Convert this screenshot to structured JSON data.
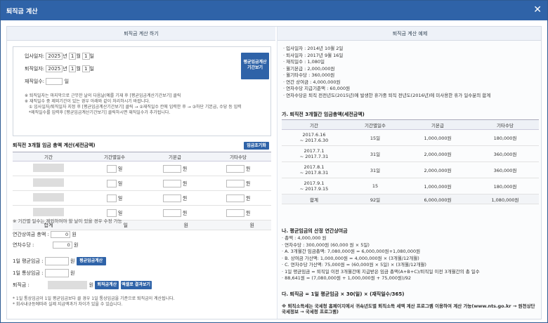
{
  "title": "퇴직금 계산",
  "close": "✕",
  "left": {
    "header": "퇴직금 계산 하기",
    "entry_label": "입사일자:",
    "leave_label": "퇴직일자:",
    "days_label": "재직일수:",
    "year": "2025",
    "y": "년",
    "month": "1",
    "m": "월",
    "day": "1",
    "d": "일",
    "days_unit": "일",
    "avg_btn": "평균임금계산 기간보기",
    "notes": [
      "※ 퇴직일자는 마지막으로 근무한 날의 다음날(예를 기재 후 [평균임금계산기간보기] 클릭",
      "※ 재직일수 중 제외기간이 있는 경우 아래와 같이 처리하시기 바랍니다.",
      "① 입사일자/퇴직일자 지정 후 [평균임금계산기간보기] 클릭 → ②재직일수 칸에 입력한 후 → ③하단 기본급, 수당 등 입력",
      "*제직일수를 입력후 [평균임금계산기간보기] 클릭하시면 재직일수가 추가됩니다."
    ],
    "section": "퇴직전 3개월 임금 총액 계산(세전금액)",
    "reset_btn": "임금초기화",
    "cols": [
      "기간",
      "기간별일수",
      "기본급",
      "기타수당"
    ],
    "day_u": "일",
    "won": "원",
    "sum": {
      "label": "합계",
      "d": "일",
      "w1": "원",
      "w2": "원"
    },
    "hint": "※ 기간별 일수는 제외하여야 할 날이 있을 경우 수정 가능",
    "bonus_label": "연간상여금 총액 :",
    "bonus_val": "0",
    "vac_label": "연차수당 :",
    "vac_val": "0",
    "avg_label": "1일 평균임금 :",
    "avg_btn2": "평균임금계산",
    "normal_label": "1일 통상임금 :",
    "sev_label": "퇴직금 :",
    "sev_btn1": "퇴직금계산",
    "sev_btn2": "엑셀로 결과보기",
    "foot": [
      "* 1일 통상임금이 1일 평균임금보다 클 경우 1일 통상임금을 기준으로 퇴직금이 계산됩니다.",
      "* 회사내규등에따라 실제 지급액과가 차이가 있을 수 있습니다."
    ]
  },
  "right": {
    "header": "퇴직금 계산 예제",
    "items": [
      "· 입사일자 : 2014년 10월 2일",
      "· 퇴사일자 : 2017년 9월 16일",
      "· 재직일수 : 1,080일",
      "· 월기본급 : 2,000,000원",
      "· 월기타수당 : 360,000원",
      "· 연간 상여금 : 4,000,000원",
      "· 연차수당 지급기준액 : 60,000원",
      "· 연차수당은 퇴직 전전년도(2015년)에 발생한 휴가중 퇴직 전년도(2016년)에 미사용한 휴가 일수분의 합계"
    ],
    "ga": "가. 퇴직전 3개월간 임금총액(세전금액)",
    "cols": [
      "기간",
      "기간별일수",
      "기본급",
      "기타수당"
    ],
    "rows": [
      [
        "2017.6.16",
        "~ 2017.6.30",
        "15일",
        "1,000,000원",
        "180,000원"
      ],
      [
        "2017.7.1",
        "~ 2017.7.31",
        "31일",
        "2,000,000원",
        "360,000원"
      ],
      [
        "2017.8.1",
        "~ 2017.8.31",
        "31일",
        "2,000,000원",
        "360,000원"
      ],
      [
        "2017.9.1",
        "~ 2017.9.15",
        "15",
        "1,000,000원",
        "180,000원"
      ]
    ],
    "sum": [
      "합계",
      "92일",
      "6,000,000원",
      "1,080,000원"
    ],
    "na": "나. 평균임금의 산정 연간상여금",
    "calc": [
      "· 총액 : 4,000,000 원",
      "· 연차수당 : 300,000원 (60,000 원 × 5일)",
      "· A. 3개월간 임금총액: 7,080,000원 = 6,000,000원+1,080,000원",
      "· B. 상여금 가산액: 1,000,000원 = 4,000,000원 × (3개월/12개월)",
      "· C. 연차수당 가산액: 75,000원 = (60,000원 × 5일) × (3개월/12개월)",
      "· 1일 평균임금 = 퇴직일 이전 3개월간에 지급받은 임금 총액(A+B+C)/퇴직일 이전 3개월간의 총 일수",
      "· 88,641원 = (7,080,000원 + 1,000,000원 + 75,000원)/92"
    ],
    "da": "다. 퇴직금 = 1일 평균임금 × 30(일) × (재직일수/365)",
    "link": "※ 퇴직소득세는 국세청 홈페이지에서 귀속년도별 퇴직소득 세액 계산 프로그램 이용하여 계산 가능(www.nts.go.kr → 원천상단 국세정보 → 국세청 프로그램)"
  }
}
